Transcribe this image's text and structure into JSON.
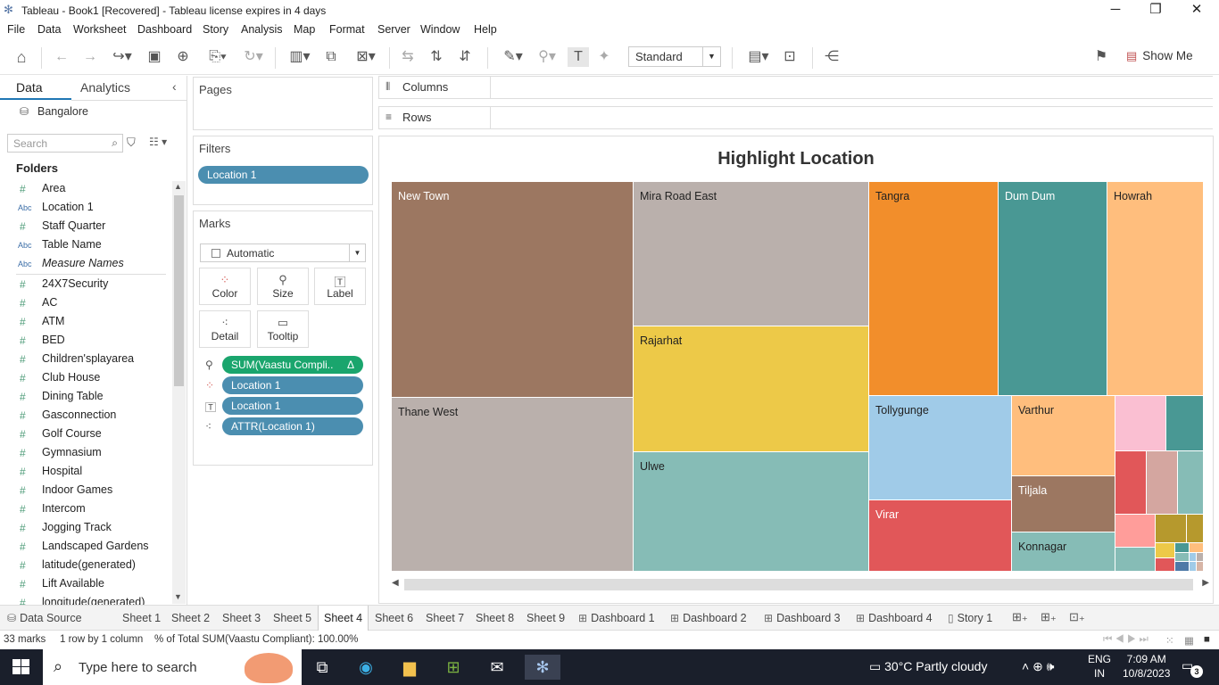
{
  "window": {
    "title": "Tableau - Book1 [Recovered] - Tableau license expires in 4 days"
  },
  "menu": [
    "File",
    "Data",
    "Worksheet",
    "Dashboard",
    "Story",
    "Analysis",
    "Map",
    "Format",
    "Server",
    "Window",
    "Help"
  ],
  "toolbar": {
    "fit_select": "Standard",
    "show_me": "Show Me"
  },
  "left_pane": {
    "tabs": {
      "data": "Data",
      "analytics": "Analytics"
    },
    "datasource": "Bangalore",
    "search_placeholder": "Search",
    "folders_label": "Folders",
    "dimensions": [
      {
        "type": "#",
        "label": "Area"
      },
      {
        "type": "Abc",
        "label": "Location 1"
      },
      {
        "type": "#",
        "label": "Staff Quarter"
      },
      {
        "type": "Abc",
        "label": "Table Name"
      },
      {
        "type": "Abc",
        "label": "Measure Names"
      }
    ],
    "measures": [
      "24X7Security",
      "AC",
      "ATM",
      "BED",
      "Children'splayarea",
      "Club House",
      "Dining Table",
      "Gasconnection",
      "Golf Course",
      "Gymnasium",
      "Hospital",
      "Indoor Games",
      "Intercom",
      "Jogging Track",
      "Landscaped Gardens",
      "latitude(generated)",
      "Lift Available",
      "longitude(generated)"
    ]
  },
  "pages_card": {
    "title": "Pages"
  },
  "filters_card": {
    "title": "Filters",
    "pill": "Location 1"
  },
  "marks_card": {
    "title": "Marks",
    "mark_type": "Automatic",
    "buttons": {
      "color": "Color",
      "size": "Size",
      "label": "Label",
      "detail": "Detail",
      "tooltip": "Tooltip"
    },
    "pills": {
      "size": "SUM(Vaastu Compli..",
      "color": "Location 1",
      "label": "Location 1",
      "detail": "ATTR(Location 1)",
      "delta": "Δ"
    }
  },
  "shelves": {
    "columns": "Columns",
    "rows": "Rows"
  },
  "view": {
    "title": "Highlight Location"
  },
  "treemap": {
    "labels": [
      "New Town",
      "Mira Road East",
      "Tangra",
      "Dum Dum",
      "Howrah",
      "Rajarhat",
      "Thane West",
      "Ulwe",
      "Tollygunge",
      "Varthur",
      "Tiljala",
      "Virar",
      "Konnagar"
    ],
    "colors": {
      "New Town": "#9c7761",
      "Mira Road East": "#bab0ac",
      "Tangra": "#f28e2b",
      "Dum Dum": "#499894",
      "Howrah": "#ffbe7d",
      "Rajarhat": "#edc948",
      "Thane West": "#bab0ac",
      "Ulwe": "#86bcb6",
      "Tollygunge": "#a0cbe8",
      "Varthur": "#ffbe7d",
      "Tiljala": "#9c7761",
      "Virar": "#e15759",
      "Konnagar": "#86bcb6"
    }
  },
  "sheet_tabs": [
    "Data Source",
    "Sheet 1",
    "Sheet 2",
    "Sheet 3",
    "Sheet 5",
    "Sheet 4",
    "Sheet 6",
    "Sheet 7",
    "Sheet 8",
    "Sheet 9",
    "Dashboard 1",
    "Dashboard 2",
    "Dashboard 3",
    "Dashboard 4",
    "Story 1"
  ],
  "active_tab": "Sheet 4",
  "status": {
    "marks": "33 marks",
    "dims": "1 row by 1 column",
    "total": "% of Total SUM(Vaastu Compliant): 100.00%"
  },
  "taskbar": {
    "search_text": "Type here to search",
    "weather": "30°C  Partly cloudy",
    "lang1": "ENG",
    "lang2": "IN",
    "time": "7:09 AM",
    "date": "10/8/2023",
    "notifications": "3"
  }
}
